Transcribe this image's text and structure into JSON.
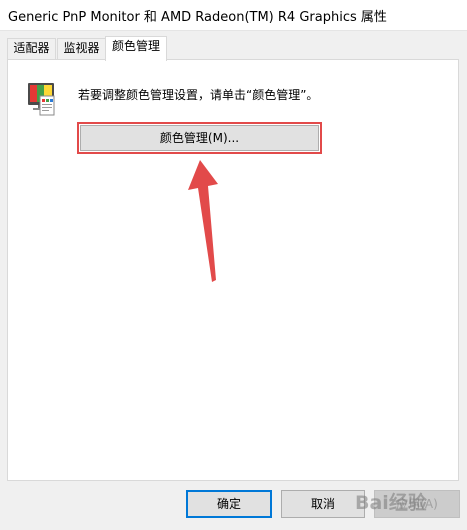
{
  "window": {
    "title": "Generic PnP Monitor 和 AMD Radeon(TM) R4 Graphics 属性"
  },
  "tabs": [
    {
      "label": "适配器"
    },
    {
      "label": "监视器"
    },
    {
      "label": "颜色管理",
      "active": true
    }
  ],
  "panel": {
    "description": "若要调整颜色管理设置，请单击“颜色管理”。",
    "color_management_button": "颜色管理(M)...",
    "icon": "color-management-icon"
  },
  "footer": {
    "ok_label": "确定",
    "cancel_label": "取消",
    "apply_label": "应用(A)"
  },
  "annotation": {
    "highlight_color": "#e24a4a",
    "arrow_color": "#e24a4a"
  },
  "watermark": "Bai经验"
}
